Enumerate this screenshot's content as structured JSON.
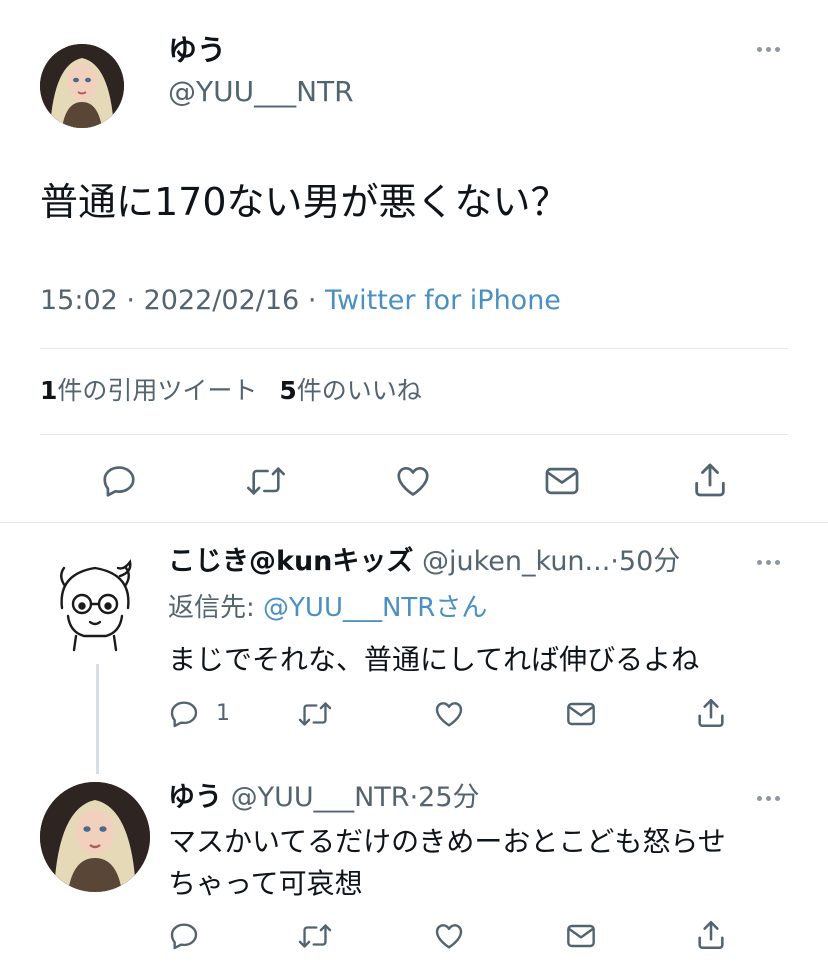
{
  "main_tweet": {
    "display_name": "ゆう",
    "handle": "@YUU___NTR",
    "text": "普通に170ない男が悪くない？",
    "time": "15:02",
    "date": "2022/02/16",
    "source": "Twitter for iPhone",
    "quote_count": "1",
    "quote_label": "件の引用ツイート",
    "like_count": "5",
    "like_label": "件のいいね"
  },
  "replies": [
    {
      "display_name": "こじき@kunキッズ",
      "handle": "@juken_kun...",
      "age": "50分",
      "reply_to_prefix": "返信先: ",
      "reply_to_handle": "@YUU___NTRさん",
      "text": "まじでそれな、普通にしてれば伸びるよね",
      "reply_count": "1"
    },
    {
      "display_name": "ゆう",
      "handle": "@YUU___NTR",
      "age": "25分",
      "text_line1": "マスかいてるだけのきめーおとこども怒らせ",
      "text_line2": "ちゃって可哀想"
    }
  ],
  "separators": {
    "dot": "·"
  },
  "colors": {
    "link": "#4a90c2",
    "muted": "#536471",
    "icon": "#536471",
    "divider": "#e6e9eb"
  },
  "icons": [
    "reply-icon",
    "retweet-icon",
    "like-icon",
    "message-icon",
    "share-icon",
    "more-icon"
  ]
}
